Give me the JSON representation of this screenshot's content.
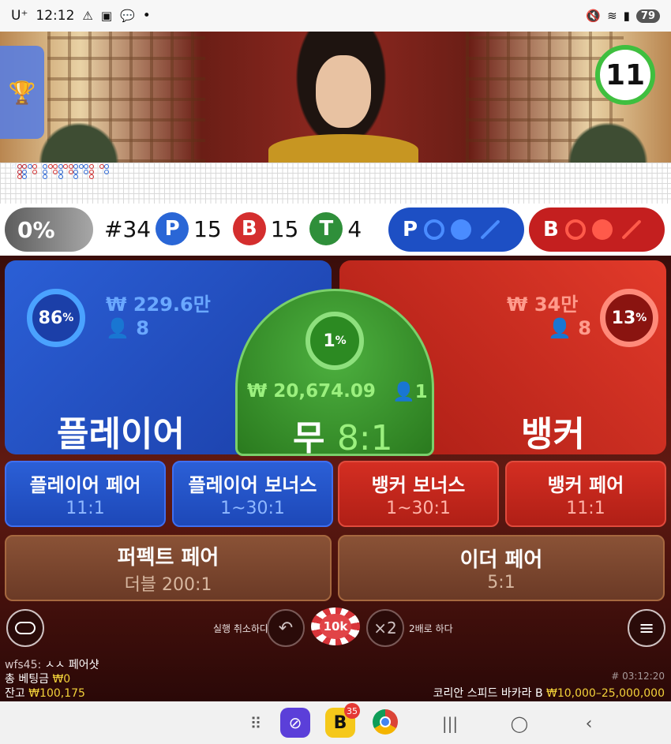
{
  "status": {
    "carrier": "U⁺",
    "time": "12:12",
    "battery": "79",
    "dot": "•"
  },
  "video": {
    "timer": "11",
    "trophy_icon": "trophy-icon"
  },
  "stats": {
    "pct": "0%",
    "shoe": "#34",
    "player_label": "P",
    "player_count": "15",
    "banker_label": "B",
    "banker_count": "15",
    "tie_label": "T",
    "tie_count": "4",
    "predict_player": "P",
    "predict_banker": "B"
  },
  "player": {
    "pct": "86",
    "pct_sign": "%",
    "money": "₩ 229.6만",
    "people": "8",
    "label": "플레이어"
  },
  "banker": {
    "pct": "13",
    "pct_sign": "%",
    "money": "₩ 34만",
    "people": "8",
    "label": "뱅커"
  },
  "tie": {
    "pct": "1",
    "pct_sign": "%",
    "money": "₩ 20,674.09",
    "people": "1",
    "label": "무",
    "odds": "8:1"
  },
  "side_bets": [
    {
      "title": "플레이어 페어",
      "odds": "11:1"
    },
    {
      "title": "플레이어 보너스",
      "odds": "1~30:1"
    },
    {
      "title": "뱅커 보너스",
      "odds": "1~30:1"
    },
    {
      "title": "뱅커 페어",
      "odds": "11:1"
    }
  ],
  "pairs": [
    {
      "title": "퍼펙트 페어",
      "odds": "더블 200:1"
    },
    {
      "title": "이더 페어",
      "odds": "5:1"
    }
  ],
  "controls": {
    "undo_label": "실행 취소하다",
    "chip_value": "10k",
    "double_symbol": "×2",
    "double_label": "2배로 하다"
  },
  "footer": {
    "chat_user": "wfs45:",
    "chat_msg": "ㅅㅅ 페어샷",
    "total_bet_label": "총 베팅금",
    "total_bet_value": "₩0",
    "balance_label": "잔고",
    "balance_value": "₩100,175",
    "round_id": "# 03:12:20",
    "table_name": "코리안 스피드 바카라 B",
    "limits": "₩10,000–25,000,000"
  },
  "navbar": {
    "badge": "35",
    "b_letter": "B"
  },
  "colors": {
    "player_blue": "#1d4fc4",
    "banker_red": "#c41f1f",
    "tie_green": "#3a9a2e",
    "highlight_yellow": "#f3d23a"
  }
}
